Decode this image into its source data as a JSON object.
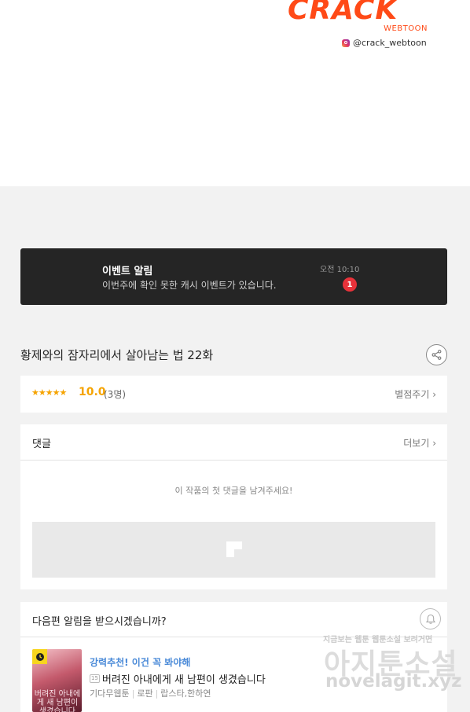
{
  "brand": {
    "logo": "CRACK",
    "sub": "WEBTOON",
    "instagram": "@crack_webtoon"
  },
  "event": {
    "title": "이벤트 알림",
    "desc": "이번주에 확인 못한 캐시 이벤트가 있습니다.",
    "time": "오전 10:10",
    "badge": "1"
  },
  "episode": {
    "title": "황제와의 잠자리에서 살아남는 법 22화"
  },
  "rating": {
    "stars": "★★★★★",
    "score": "10.0",
    "votes": "(3명)",
    "rate_label": "별점주기 ›"
  },
  "comments": {
    "title": "댓글",
    "more": "더보기 ›",
    "empty": "이 작품의 첫 댓글을 남겨주세요!"
  },
  "next": {
    "title": "다음편 알림을 받으시겠습니까?",
    "rec_label": "강력추천! 이건 꼭 봐야해",
    "age": "15",
    "rec_title": "버려진 아내에게 새 남편이 생겼습니다",
    "meta": [
      "기다무웹툰",
      "로판",
      "랍스타,한하연"
    ],
    "thumb_text": "버려진 아내에게 새 남편이 생겼습니다"
  },
  "watermark": {
    "small": "지금보는 웹툰 웹툰소설 보려거면",
    "big": "아지툰소설",
    "url": "novelagit.xyz"
  },
  "colors": {
    "brand": "#ff4a17",
    "star": "#f5a300",
    "badge": "#e8323a",
    "link_blue": "#4a8ad8"
  }
}
